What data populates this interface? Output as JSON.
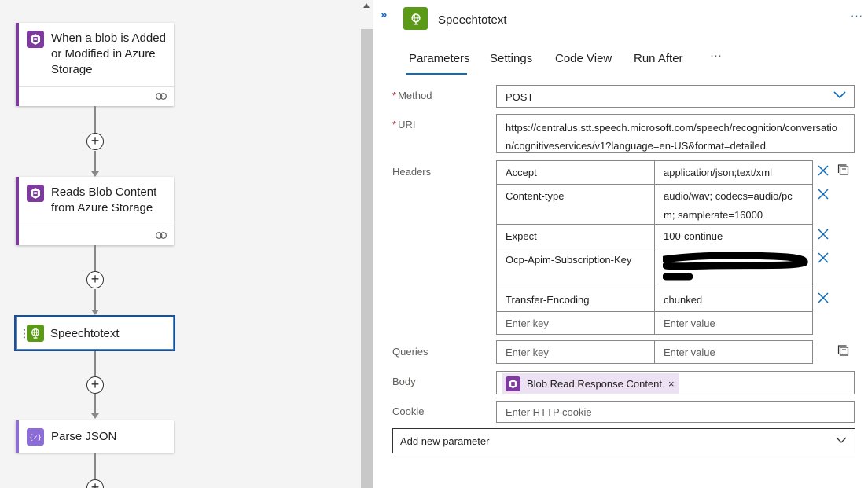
{
  "workflow": {
    "trigger_title": "When a blob is Added or Modified in Azure Storage",
    "read_title": "Reads Blob Content from Azure Storage",
    "speech_title": "Speechtotext",
    "parse_title": "Parse JSON"
  },
  "panel": {
    "title": "Speechtotext",
    "more_label": "···",
    "tabs": [
      {
        "label": "Parameters",
        "active": true
      },
      {
        "label": "Settings",
        "active": false
      },
      {
        "label": "Code View",
        "active": false
      },
      {
        "label": "Run After",
        "active": false
      },
      {
        "label": "···",
        "active": false
      }
    ]
  },
  "form": {
    "method_label": "Method",
    "method_value": "POST",
    "uri_label": "URI",
    "uri_value": "https://centralus.stt.speech.microsoft.com/speech/recognition/conversation/cognitiveservices/v1?language=en-US&format=detailed",
    "headers_label": "Headers",
    "headers": [
      {
        "key": "Accept",
        "value": "application/json;text/xml"
      },
      {
        "key": "Content-type",
        "value": "audio/wav; codecs=audio/pcm; samplerate=16000"
      },
      {
        "key": "Expect",
        "value": "100-continue"
      },
      {
        "key": "Ocp-Apim-Subscription-Key",
        "value": ""
      },
      {
        "key": "Transfer-Encoding",
        "value": "chunked"
      }
    ],
    "key_placeholder": "Enter key",
    "value_placeholder": "Enter value",
    "queries_label": "Queries",
    "body_label": "Body",
    "body_token": "Blob Read Response Content",
    "body_token_remove": "×",
    "cookie_label": "Cookie",
    "cookie_placeholder": "Enter HTTP cookie",
    "add_parameter_label": "Add new parameter"
  },
  "colors": {
    "accent": "#0f6cbd",
    "trigger_accent": "#7e3a9e",
    "speech_icon": "#5a9a16",
    "parse_accent": "#8c6cd9",
    "token_bg": "#ede1f4"
  }
}
